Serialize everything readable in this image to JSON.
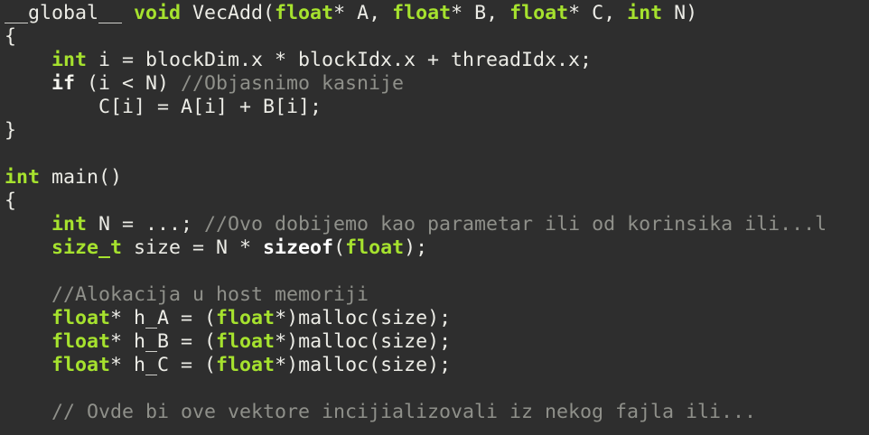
{
  "theme": {
    "background": "#2e2e2e",
    "text": "#ecece6",
    "type_color": "#a6e22e",
    "keyword_color": "#f4f4ee",
    "comment_color": "#8f908a"
  },
  "code": {
    "lines": [
      [
        {
          "t": "__global__ ",
          "k": "plain"
        },
        {
          "t": "void",
          "k": "type"
        },
        {
          "t": " VecAdd(",
          "k": "plain"
        },
        {
          "t": "float",
          "k": "type"
        },
        {
          "t": "* A, ",
          "k": "plain"
        },
        {
          "t": "float",
          "k": "type"
        },
        {
          "t": "* B, ",
          "k": "plain"
        },
        {
          "t": "float",
          "k": "type"
        },
        {
          "t": "* C, ",
          "k": "plain"
        },
        {
          "t": "int",
          "k": "type"
        },
        {
          "t": " N)",
          "k": "plain"
        }
      ],
      [
        {
          "t": "{",
          "k": "plain"
        }
      ],
      [
        {
          "t": "    ",
          "k": "plain"
        },
        {
          "t": "int",
          "k": "type"
        },
        {
          "t": " i = blockDim.x * blockIdx.x + threadIdx.x;",
          "k": "plain"
        }
      ],
      [
        {
          "t": "    ",
          "k": "plain"
        },
        {
          "t": "if",
          "k": "kw"
        },
        {
          "t": " (i < N) ",
          "k": "plain"
        },
        {
          "t": "//Objasnimo kasnije",
          "k": "comment"
        }
      ],
      [
        {
          "t": "        C[i] = A[i] + B[i];",
          "k": "plain"
        }
      ],
      [
        {
          "t": "}",
          "k": "plain"
        }
      ],
      [],
      [
        {
          "t": "int",
          "k": "type"
        },
        {
          "t": " main()",
          "k": "plain"
        }
      ],
      [
        {
          "t": "{",
          "k": "plain"
        }
      ],
      [
        {
          "t": "    ",
          "k": "plain"
        },
        {
          "t": "int",
          "k": "type"
        },
        {
          "t": " N = ...; ",
          "k": "plain"
        },
        {
          "t": "//Ovo dobijemo kao parametar ili od korinsika ili...l",
          "k": "comment"
        }
      ],
      [
        {
          "t": "    ",
          "k": "plain"
        },
        {
          "t": "size_t",
          "k": "type"
        },
        {
          "t": " size = N * ",
          "k": "plain"
        },
        {
          "t": "sizeof",
          "k": "bold"
        },
        {
          "t": "(",
          "k": "plain"
        },
        {
          "t": "float",
          "k": "type"
        },
        {
          "t": ");",
          "k": "plain"
        }
      ],
      [],
      [
        {
          "t": "    ",
          "k": "plain"
        },
        {
          "t": "//Alokacija u host memoriji",
          "k": "comment"
        }
      ],
      [
        {
          "t": "    ",
          "k": "plain"
        },
        {
          "t": "float",
          "k": "type"
        },
        {
          "t": "* h_A = (",
          "k": "plain"
        },
        {
          "t": "float",
          "k": "type"
        },
        {
          "t": "*)malloc(size);",
          "k": "plain"
        }
      ],
      [
        {
          "t": "    ",
          "k": "plain"
        },
        {
          "t": "float",
          "k": "type"
        },
        {
          "t": "* h_B = (",
          "k": "plain"
        },
        {
          "t": "float",
          "k": "type"
        },
        {
          "t": "*)malloc(size);",
          "k": "plain"
        }
      ],
      [
        {
          "t": "    ",
          "k": "plain"
        },
        {
          "t": "float",
          "k": "type"
        },
        {
          "t": "* h_C = (",
          "k": "plain"
        },
        {
          "t": "float",
          "k": "type"
        },
        {
          "t": "*)malloc(size);",
          "k": "plain"
        }
      ],
      [],
      [
        {
          "t": "    ",
          "k": "plain"
        },
        {
          "t": "// Ovde bi ove vektore incijializovali iz nekog fajla ili...",
          "k": "comment"
        }
      ]
    ]
  }
}
